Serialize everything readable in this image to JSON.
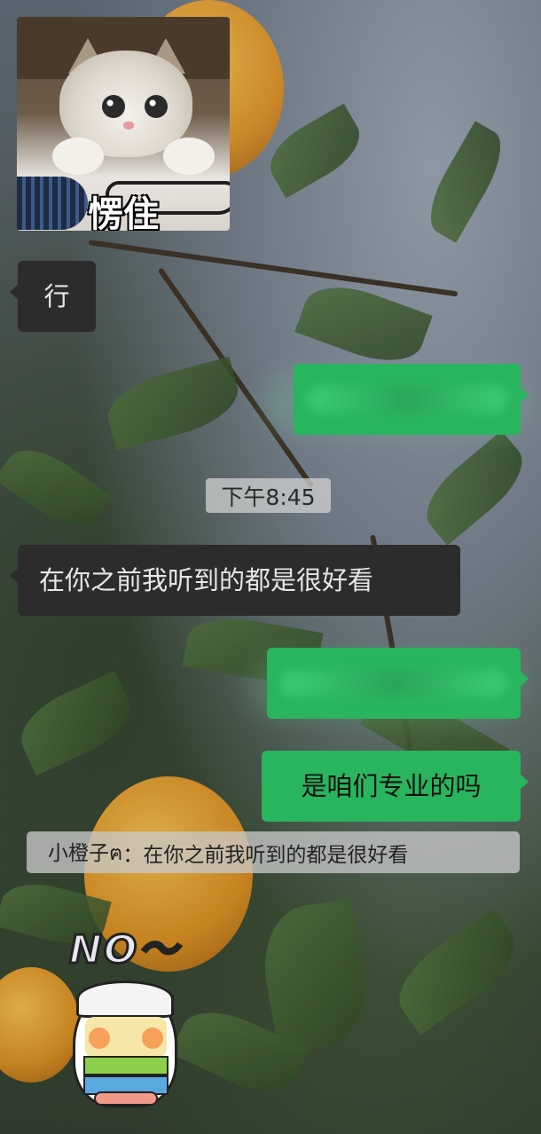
{
  "messages": {
    "sticker_cat": {
      "caption": "愣住"
    },
    "msg_ok": {
      "text": "行"
    },
    "timestamp": {
      "text": "下午8:45"
    },
    "msg_before_you": {
      "text": "在你之前我听到的都是很好看"
    },
    "msg_same_major": {
      "text": "是咱们专业的吗"
    },
    "quote": {
      "sender": "小橙子ฅ",
      "separator": "：",
      "text": "在你之前我听到的都是很好看"
    },
    "sticker_chick": {
      "text": "NO～"
    }
  },
  "colors": {
    "incoming_bubble": "#2c2c2c",
    "outgoing_bubble": "#29b55e",
    "time_pill": "#d2d2d2"
  },
  "icons": [
    "cat-sticker-icon",
    "chick-sticker-icon"
  ]
}
